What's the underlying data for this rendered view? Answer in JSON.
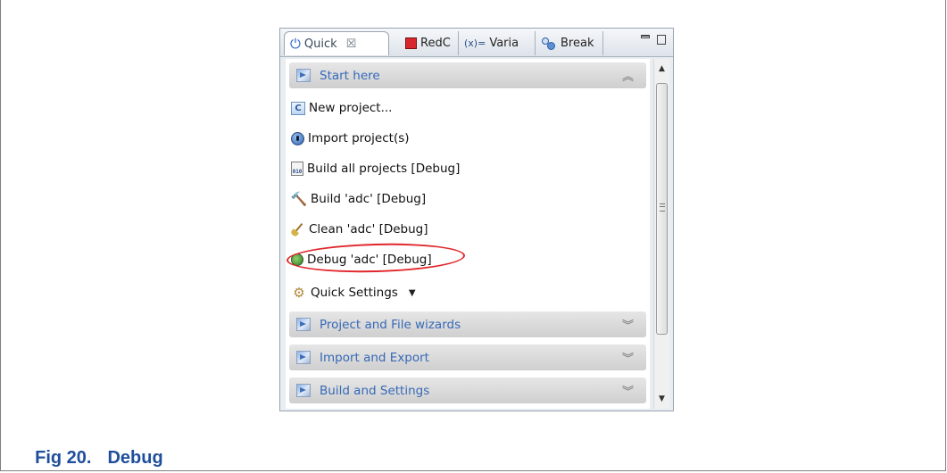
{
  "caption": {
    "number": "Fig 20.",
    "title": "Debug"
  },
  "tabs": [
    {
      "label": "Quick",
      "icon": "power-icon",
      "active": true
    },
    {
      "label": "RedC",
      "icon": "redc-icon",
      "active": false
    },
    {
      "label": "Varia",
      "icon": "variables-icon",
      "prefix": "(x)=",
      "active": false
    },
    {
      "label": "Break",
      "icon": "breakpoints-icon",
      "active": false
    }
  ],
  "sections": {
    "start_here": {
      "label": "Start here",
      "expanded": true
    },
    "project_wizards": {
      "label": "Project and File wizards",
      "expanded": false
    },
    "import_export": {
      "label": "Import and Export",
      "expanded": false
    },
    "build_settings": {
      "label": "Build and Settings",
      "expanded": false
    }
  },
  "start_items": [
    {
      "label": "New project...",
      "icon": "new-project-icon"
    },
    {
      "label": "Import project(s)",
      "icon": "import-icon"
    },
    {
      "label": "Build all projects [Debug]",
      "icon": "build-all-icon"
    },
    {
      "label": "Build 'adc' [Debug]",
      "icon": "hammer-icon"
    },
    {
      "label": "Clean 'adc' [Debug]",
      "icon": "broom-icon"
    },
    {
      "label": "Debug 'adc' [Debug]",
      "icon": "bug-icon",
      "highlighted": true
    },
    {
      "label": "Quick Settings",
      "icon": "settings-icon",
      "has_dropdown": true
    }
  ],
  "colors": {
    "caption": "#1f4e9c",
    "section_text": "#3569b8",
    "highlight": "#e0262c"
  },
  "glyphs": {
    "close": "☒",
    "collapse": "⌃",
    "expand": "⌄",
    "dropdown": "▼",
    "scroll_up": "▲",
    "scroll_down": "▼",
    "buildall_text": "010"
  }
}
